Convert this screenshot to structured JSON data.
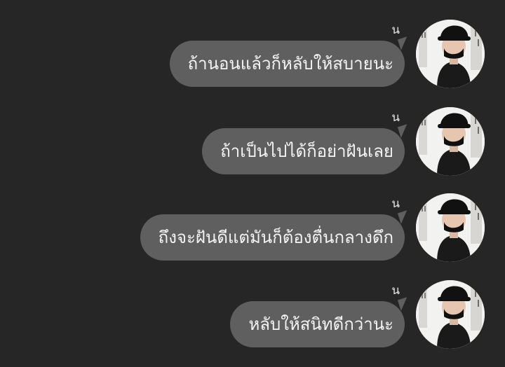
{
  "colors": {
    "background": "#262626",
    "bubble": "#5f5f5f",
    "bubble_text": "#f4f4f4",
    "sender_text": "#e6e6e6"
  },
  "messages": [
    {
      "sender": "น",
      "text": "ถ้านอนแล้วก็หลับให้สบายนะ",
      "avatar_icon": "profile-photo"
    },
    {
      "sender": "น",
      "text": "ถ้าเป็นไปได้ก็อย่าฝันเลย",
      "avatar_icon": "profile-photo"
    },
    {
      "sender": "น",
      "text": "ถึงจะฝันดีแต่มันก็ต้องตื่นกลางดึก",
      "avatar_icon": "profile-photo"
    },
    {
      "sender": "น",
      "text": "หลับให้สนิทดีกว่านะ",
      "avatar_icon": "profile-photo"
    }
  ]
}
